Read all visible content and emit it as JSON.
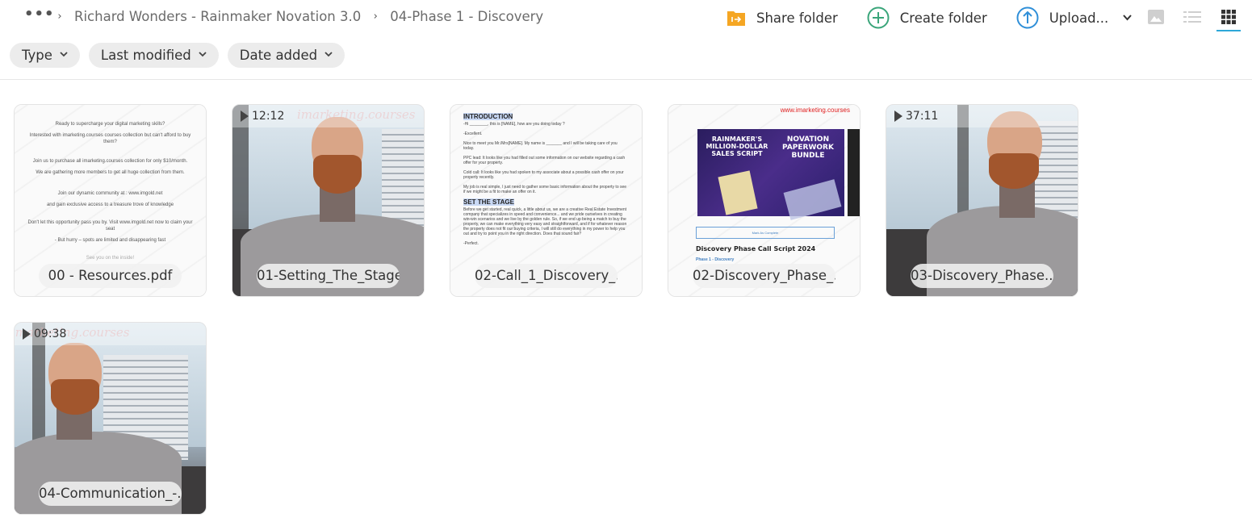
{
  "breadcrumb": {
    "more_label": "•••",
    "separator": "›",
    "items": [
      {
        "label": "Richard Wonders - Rainmaker Novation 3.0"
      },
      {
        "label": "04-Phase 1 - Discovery"
      }
    ]
  },
  "toolbar": {
    "share_label": "Share folder",
    "create_label": "Create folder",
    "upload_label": "Upload...",
    "upload_caret": "⌄",
    "view_modes": [
      {
        "name": "photo-view",
        "active": false
      },
      {
        "name": "list-view",
        "active": false
      },
      {
        "name": "grid-view",
        "active": true
      }
    ],
    "colors": {
      "share": "#f5a623",
      "create": "#3aa57a",
      "upload": "#2f8fd8",
      "active_view": "#2ea7d8"
    }
  },
  "filters": [
    {
      "label": "Type",
      "chevron": "⌄"
    },
    {
      "label": "Last modified",
      "chevron": "⌄"
    },
    {
      "label": "Date added",
      "chevron": "⌄"
    }
  ],
  "files": [
    {
      "name": "00 - Resources.pdf",
      "kind": "pdf",
      "preview_lines": [
        "Ready to supercharge your digital marketing skills?",
        "Interested with imarketing.courses courses collection but can't afford to buy them?",
        "Join us to purchase all imarketing.courses collection for only $10/month.",
        "We are gathering more members to get all huge collection from them.",
        "Join our dynamic community at : www.imgold.net",
        "and gain exclusive access to a treasure trove of knowledge",
        "Don't let this opportunity pass you by. Visit www.imgold.net now to claim your seat",
        "- But hurry – spots are limited and disappearing fast",
        "See you on the inside!"
      ]
    },
    {
      "name": "01-Setting_The_Stage...",
      "kind": "video",
      "duration": "12:12",
      "watermark": "imarketing.courses"
    },
    {
      "name": "02-Call_1_Discovery_...",
      "kind": "document",
      "preview": {
        "h1": "INTRODUCTION",
        "lines1": [
          "-Hi ________, this is [NAME], how are you doing today ?",
          "-Excellent.",
          "Nice to meet you Mr./Mrs[NAME]. My name is _______ and I will be taking care of you today.",
          "PPC lead: It looks like you had filled out some information on our website regarding a cash offer for your property.",
          "Cold call: It looks like you had spoken to my associate about a possible cash offer on your property recently.",
          "My job is real simple, I just need to gather some basic information about the property to see if we might be a fit to make an offer on it."
        ],
        "h2": "SET THE STAGE",
        "lines2": [
          "Before we get started, real quick, a little about us, we are a creative Real Estate Investment company that specializes in speed and convenience... and we pride ourselves in creating win-win scenarios and we live by the golden rule. So, if we end up being a match to buy the property, we can make everything very easy and straightforward, and if for whatever reason the property does not fit our buying criteria, I will still do everything in my power to help you out and try to point you in the right direction. Does that sound fair?",
          "-Perfect."
        ]
      }
    },
    {
      "name": "02-Discovery_Phase_...",
      "kind": "image",
      "preview": {
        "url_text": "www.imarketing.courses",
        "banner_left": "RAINMAKER'S MILLION-DOLLAR SALES SCRIPT",
        "banner_right": "NOVATION PAPERWORK BUNDLE",
        "button": "Mark As Complete",
        "title": "Discovery Phase Call Script 2024",
        "subtitle": "Phase 1 - Discovery"
      }
    },
    {
      "name": "03-Discovery_Phase....",
      "kind": "video",
      "duration": "37:11"
    },
    {
      "name": "04-Communication_-...",
      "kind": "video",
      "duration": "09:38",
      "watermark": "imarketing.courses"
    }
  ]
}
